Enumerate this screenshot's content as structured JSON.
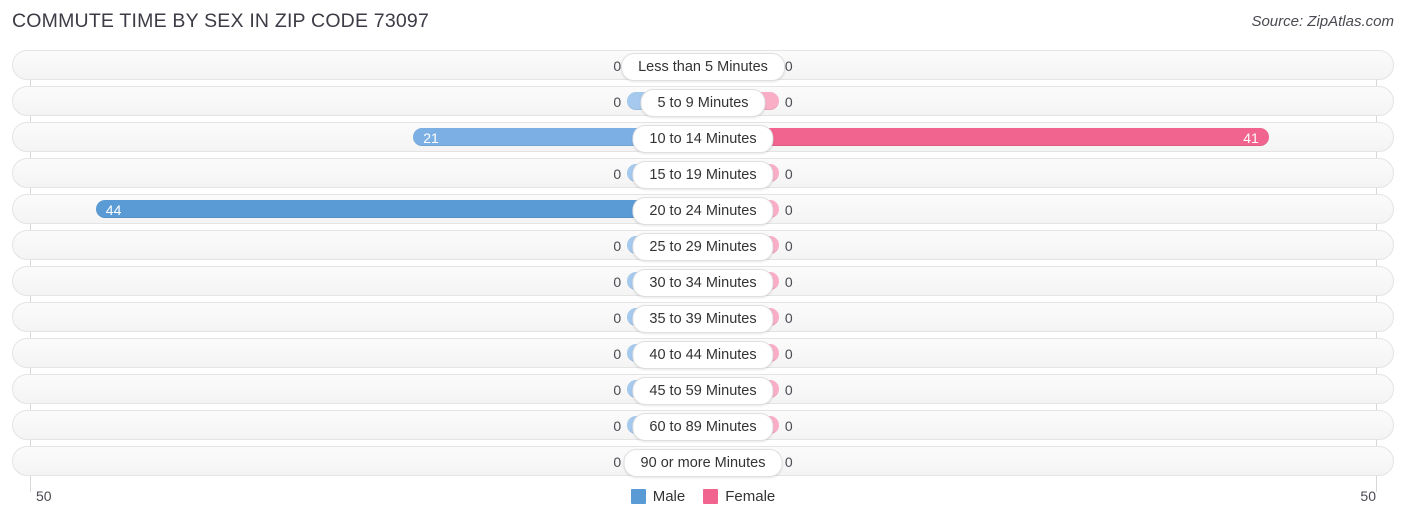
{
  "header": {
    "title": "COMMUTE TIME BY SEX IN ZIP CODE 73097",
    "source": "Source: ZipAtlas.com"
  },
  "axis": {
    "left_label": "50",
    "right_label": "50",
    "max": 50
  },
  "legend": {
    "items": [
      {
        "label": "Male",
        "color": "#5b9bd5"
      },
      {
        "label": "Female",
        "color": "#f0648f"
      }
    ]
  },
  "colors": {
    "male_zero": "#a6c9ee",
    "male_mid": "#7cb0e4",
    "male_strong": "#5b9bd5",
    "female_zero": "#f9aec6",
    "female_mid": "#f2679a",
    "female_strong": "#f0648f",
    "row_track": "#f7f7f7",
    "gridline": "#d8d8d8"
  },
  "chart_data": {
    "type": "bar",
    "title": "COMMUTE TIME BY SEX IN ZIP CODE 73097",
    "subtitle": "",
    "orientation": "horizontal-diverging",
    "xlabel": "",
    "ylabel": "",
    "xlim": [
      50,
      50
    ],
    "grid": true,
    "legend_position": "bottom-center",
    "categories": [
      "Less than 5 Minutes",
      "5 to 9 Minutes",
      "10 to 14 Minutes",
      "15 to 19 Minutes",
      "20 to 24 Minutes",
      "25 to 29 Minutes",
      "30 to 34 Minutes",
      "35 to 39 Minutes",
      "40 to 44 Minutes",
      "45 to 59 Minutes",
      "60 to 89 Minutes",
      "90 or more Minutes"
    ],
    "series": [
      {
        "name": "Male",
        "values": [
          0,
          0,
          21,
          0,
          44,
          0,
          0,
          0,
          0,
          0,
          0,
          0
        ]
      },
      {
        "name": "Female",
        "values": [
          0,
          0,
          41,
          0,
          0,
          0,
          0,
          0,
          0,
          0,
          0,
          0
        ]
      }
    ]
  },
  "rows": [
    {
      "label": "Less than 5 Minutes",
      "male": "0",
      "female": "0",
      "male_pct": 0,
      "female_pct": 0,
      "male_tone": "zero",
      "female_tone": "zero"
    },
    {
      "label": "5 to 9 Minutes",
      "male": "0",
      "female": "0",
      "male_pct": 0,
      "female_pct": 0,
      "male_tone": "zero",
      "female_tone": "zero"
    },
    {
      "label": "10 to 14 Minutes",
      "male": "21",
      "female": "41",
      "male_pct": 42,
      "female_pct": 82,
      "male_tone": "mid",
      "female_tone": "strong"
    },
    {
      "label": "15 to 19 Minutes",
      "male": "0",
      "female": "0",
      "male_pct": 0,
      "female_pct": 0,
      "male_tone": "zero",
      "female_tone": "zero"
    },
    {
      "label": "20 to 24 Minutes",
      "male": "44",
      "female": "0",
      "male_pct": 88,
      "female_pct": 0,
      "male_tone": "strong",
      "female_tone": "zero"
    },
    {
      "label": "25 to 29 Minutes",
      "male": "0",
      "female": "0",
      "male_pct": 0,
      "female_pct": 0,
      "male_tone": "zero",
      "female_tone": "zero"
    },
    {
      "label": "30 to 34 Minutes",
      "male": "0",
      "female": "0",
      "male_pct": 0,
      "female_pct": 0,
      "male_tone": "zero",
      "female_tone": "zero"
    },
    {
      "label": "35 to 39 Minutes",
      "male": "0",
      "female": "0",
      "male_pct": 0,
      "female_pct": 0,
      "male_tone": "zero",
      "female_tone": "zero"
    },
    {
      "label": "40 to 44 Minutes",
      "male": "0",
      "female": "0",
      "male_pct": 0,
      "female_pct": 0,
      "male_tone": "zero",
      "female_tone": "zero"
    },
    {
      "label": "45 to 59 Minutes",
      "male": "0",
      "female": "0",
      "male_pct": 0,
      "female_pct": 0,
      "male_tone": "zero",
      "female_tone": "zero"
    },
    {
      "label": "60 to 89 Minutes",
      "male": "0",
      "female": "0",
      "male_pct": 0,
      "female_pct": 0,
      "male_tone": "zero",
      "female_tone": "zero"
    },
    {
      "label": "90 or more Minutes",
      "male": "0",
      "female": "0",
      "male_pct": 0,
      "female_pct": 0,
      "male_tone": "zero",
      "female_tone": "zero"
    }
  ]
}
